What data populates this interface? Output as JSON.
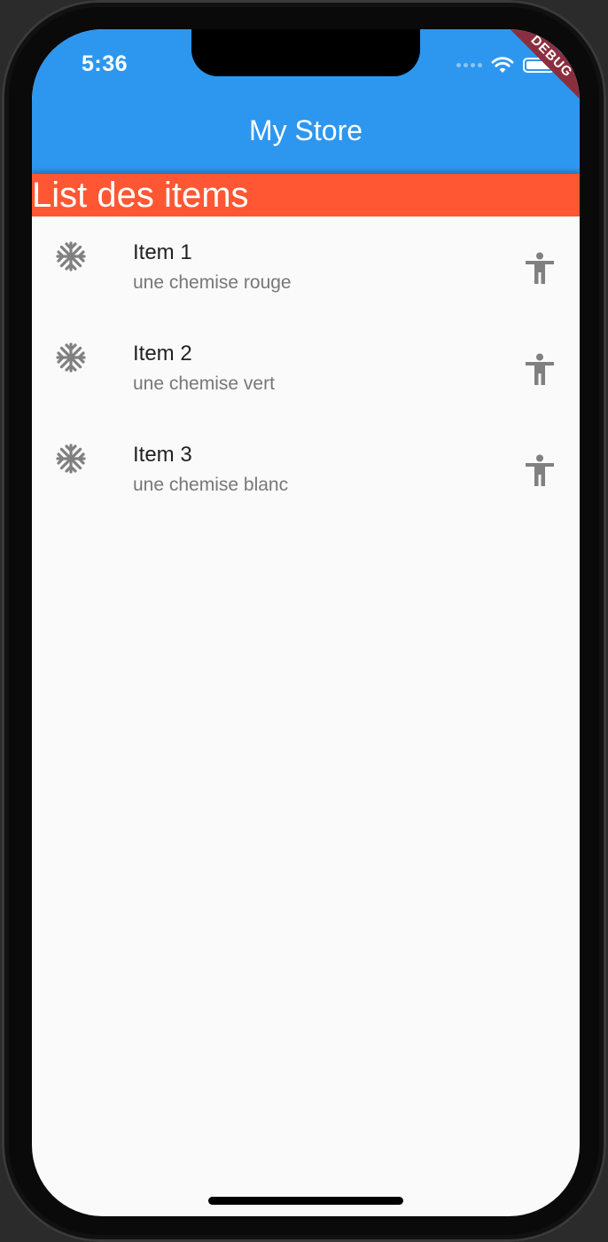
{
  "status_bar": {
    "time": "5:36",
    "wifi_icon": "wifi-icon",
    "battery_icon": "battery-icon"
  },
  "app_bar": {
    "title": "My Store",
    "background": "#2d97ef",
    "debug_banner": "DEBUG"
  },
  "section": {
    "header": "List des items",
    "background": "#ff5733"
  },
  "items": [
    {
      "title": "Item 1",
      "subtitle": "une chemise rouge",
      "leading_icon": "snowflake-icon",
      "trailing_icon": "accessibility-icon"
    },
    {
      "title": "Item 2",
      "subtitle": "une chemise vert",
      "leading_icon": "snowflake-icon",
      "trailing_icon": "accessibility-icon"
    },
    {
      "title": "Item 3",
      "subtitle": "une chemise blanc",
      "leading_icon": "snowflake-icon",
      "trailing_icon": "accessibility-icon"
    }
  ],
  "colors": {
    "icon": "#808080",
    "title_text": "#222222",
    "subtitle_text": "#777777",
    "page_background": "#fafafa"
  }
}
